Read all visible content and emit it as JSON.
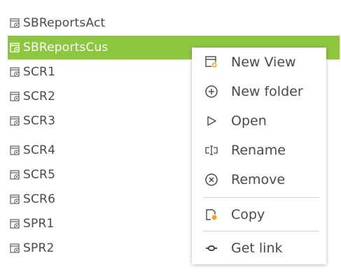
{
  "tree": {
    "items": [
      {
        "label": "SBReportsAct"
      },
      {
        "label": "SBReportsCus"
      },
      {
        "label": "SCR1"
      },
      {
        "label": "SCR2"
      },
      {
        "label": "SCR3"
      },
      {
        "label": "SCR4"
      },
      {
        "label": "SCR5"
      },
      {
        "label": "SCR6"
      },
      {
        "label": "SPR1"
      },
      {
        "label": "SPR2"
      }
    ],
    "selected_index": 1,
    "selection_color": "#8dc63f",
    "icon": "report-view-icon"
  },
  "context_menu": {
    "items": [
      {
        "label": "New View",
        "icon": "new-view-icon"
      },
      {
        "label": "New folder",
        "icon": "new-folder-icon"
      },
      {
        "label": "Open",
        "icon": "open-icon"
      },
      {
        "label": "Rename",
        "icon": "rename-icon"
      },
      {
        "label": "Remove",
        "icon": "remove-icon"
      },
      {
        "label": "Copy",
        "icon": "copy-icon"
      },
      {
        "label": "Get link",
        "icon": "get-link-icon"
      }
    ],
    "accent_color": "#f5a623"
  }
}
